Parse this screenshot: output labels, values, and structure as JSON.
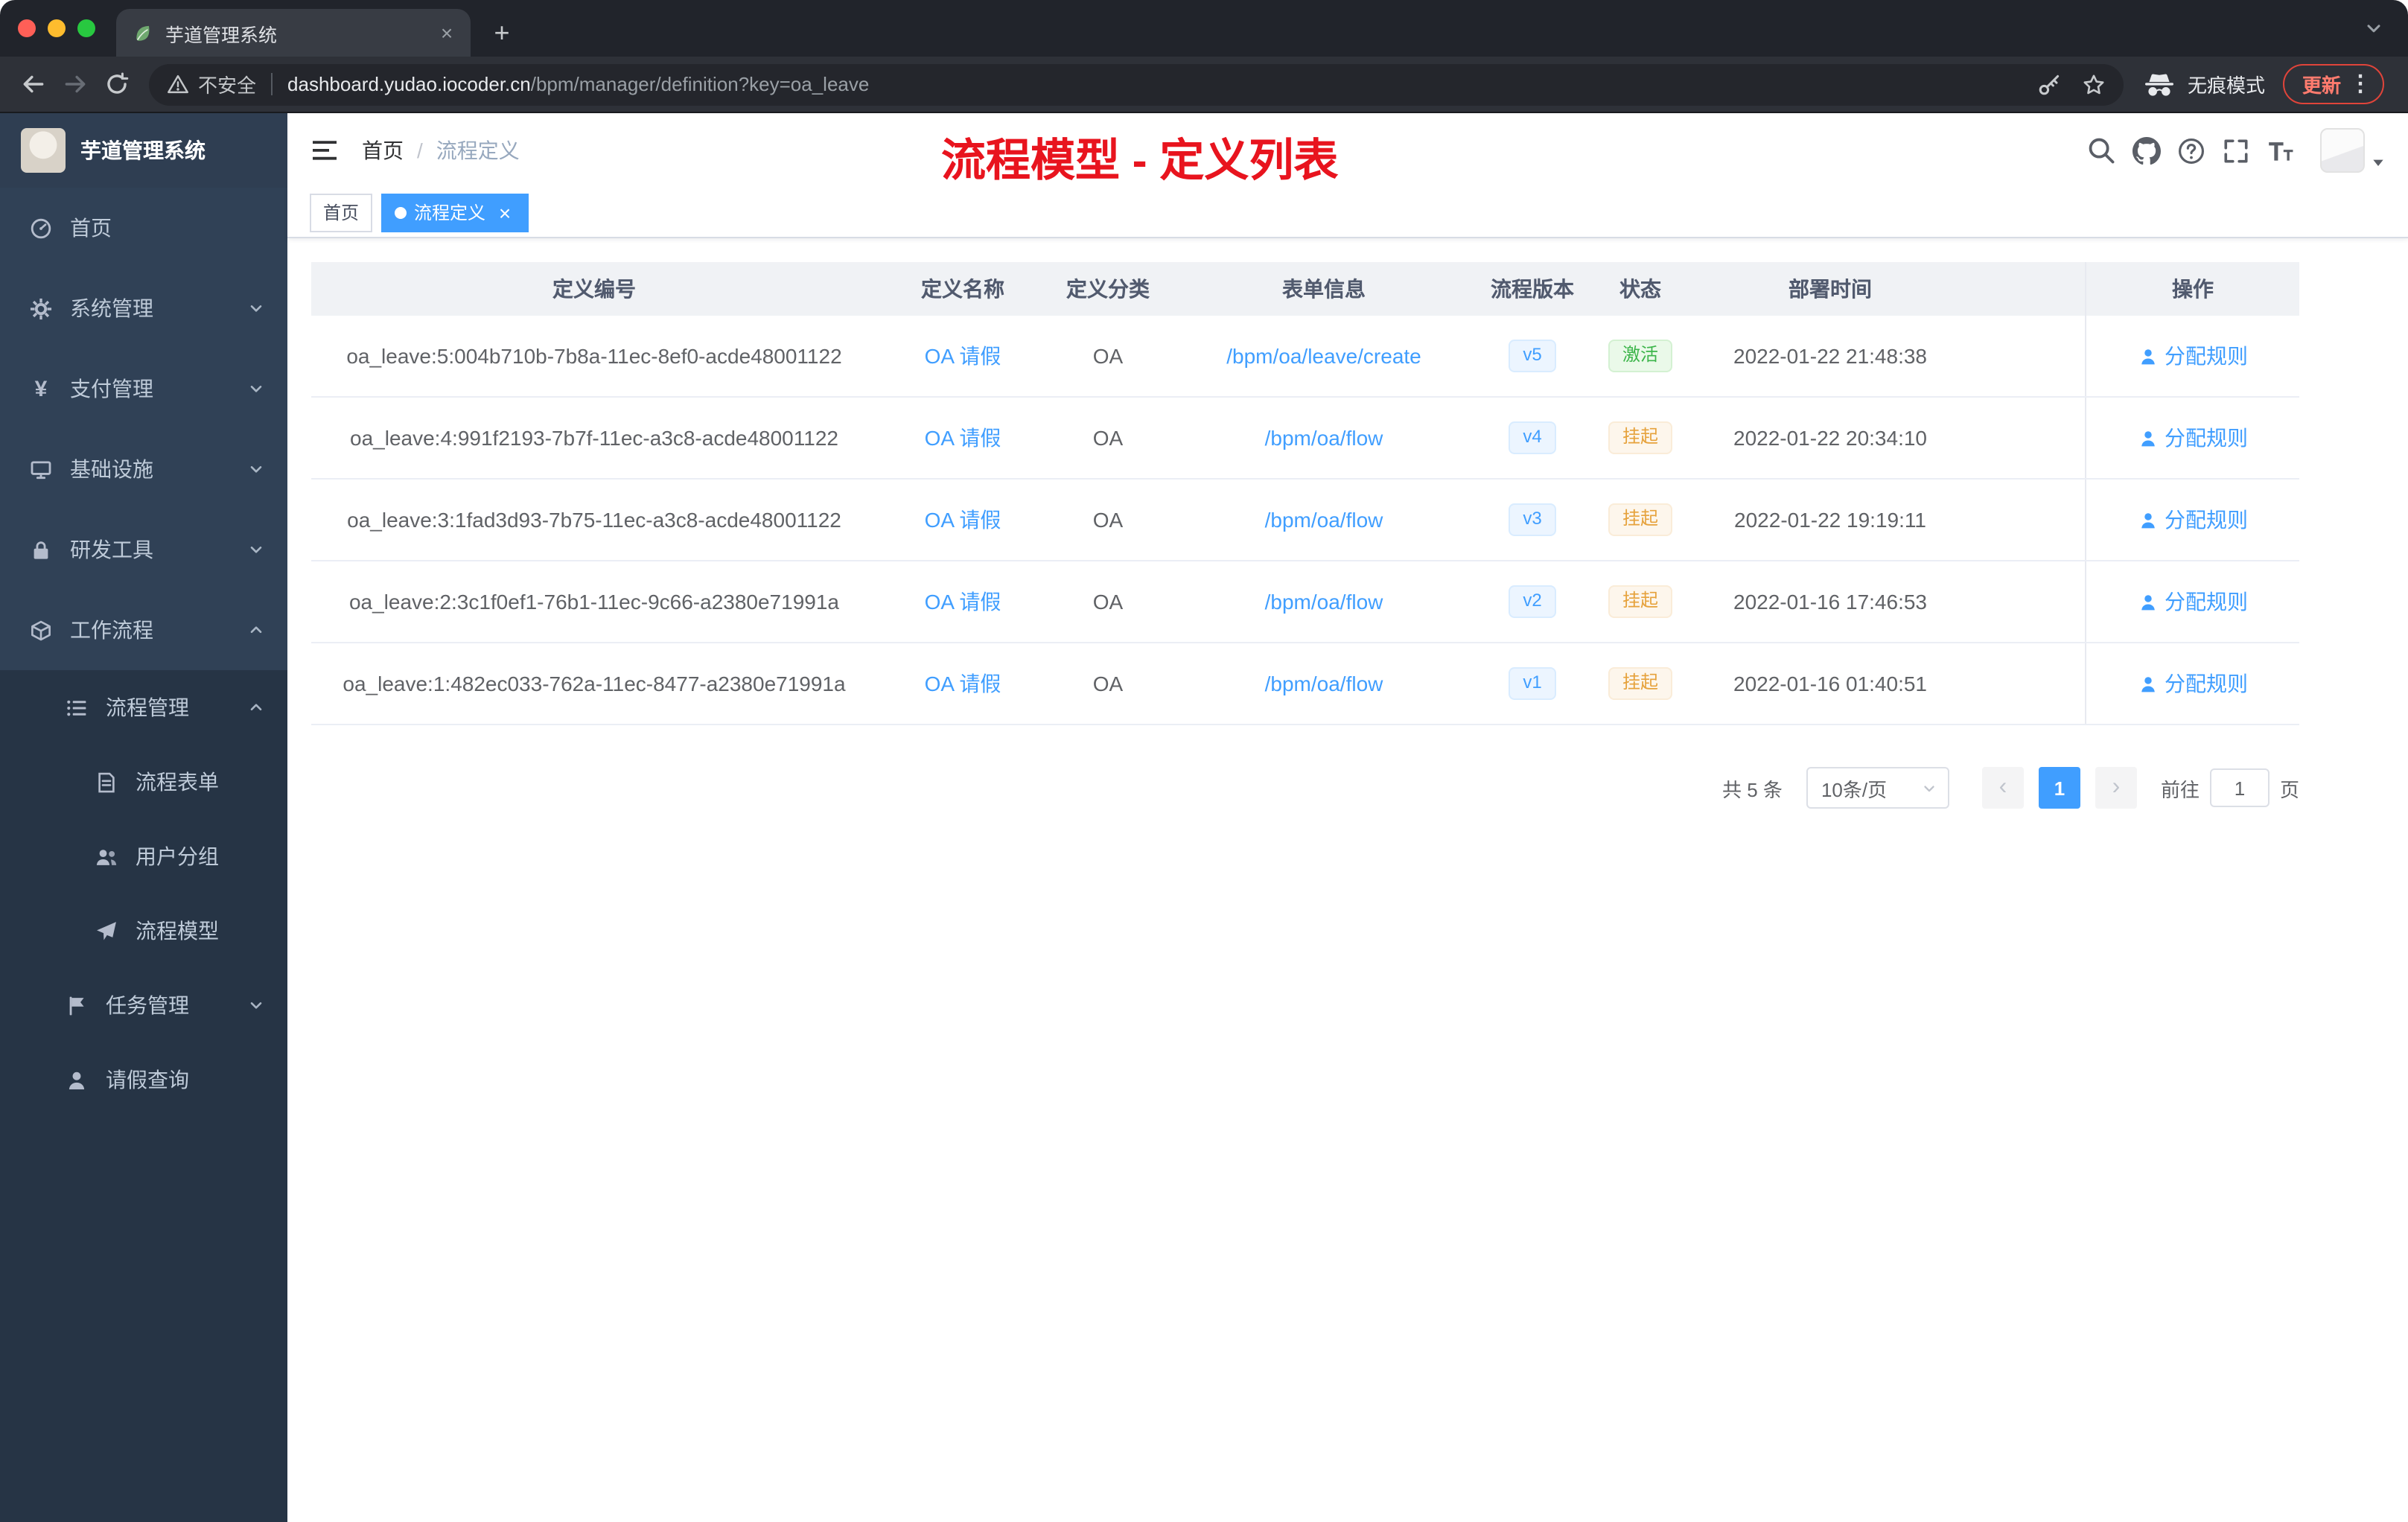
{
  "browser": {
    "tab_title": "芋道管理系统",
    "security_label": "不安全",
    "url_host": "dashboard.yudao.iocoder.cn",
    "url_path": "/bpm/manager/definition?key=oa_leave",
    "incognito_label": "无痕模式",
    "update_label": "更新"
  },
  "sidebar": {
    "logo_title": "芋道管理系统",
    "items": [
      {
        "label": "首页",
        "icon": "dashboard-icon",
        "level": 1,
        "chevron": "",
        "dark": false
      },
      {
        "label": "系统管理",
        "icon": "gear-icon",
        "level": 1,
        "chevron": "down",
        "dark": false
      },
      {
        "label": "支付管理",
        "icon": "yen-icon",
        "level": 1,
        "chevron": "down",
        "dark": false
      },
      {
        "label": "基础设施",
        "icon": "monitor-icon",
        "level": 1,
        "chevron": "down",
        "dark": false
      },
      {
        "label": "研发工具",
        "icon": "lock-icon",
        "level": 1,
        "chevron": "down",
        "dark": false
      },
      {
        "label": "工作流程",
        "icon": "workflow-icon",
        "level": 1,
        "chevron": "up",
        "dark": false
      },
      {
        "label": "流程管理",
        "icon": "list-icon",
        "level": 2,
        "chevron": "up",
        "dark": true
      },
      {
        "label": "流程表单",
        "icon": "form-icon",
        "level": 3,
        "chevron": "",
        "dark": true
      },
      {
        "label": "用户分组",
        "icon": "users-icon",
        "level": 3,
        "chevron": "",
        "dark": true
      },
      {
        "label": "流程模型",
        "icon": "send-icon",
        "level": 3,
        "chevron": "",
        "dark": true
      },
      {
        "label": "任务管理",
        "icon": "flag-icon",
        "level": 2,
        "chevron": "down",
        "dark": true
      },
      {
        "label": "请假查询",
        "icon": "user-icon",
        "level": 2,
        "chevron": "",
        "dark": true
      }
    ]
  },
  "navbar": {
    "breadcrumb": [
      "首页",
      "流程定义"
    ],
    "breadcrumb_separator": "/",
    "annotation": "流程模型 - 定义列表"
  },
  "tags": [
    {
      "label": "首页",
      "active": false
    },
    {
      "label": "流程定义",
      "active": true
    }
  ],
  "table": {
    "headers": [
      "定义编号",
      "定义名称",
      "定义分类",
      "表单信息",
      "流程版本",
      "状态",
      "部署时间",
      "操作"
    ],
    "action_label": "分配规则",
    "rows": [
      {
        "id": "oa_leave:5:004b710b-7b8a-11ec-8ef0-acde48001122",
        "name": "OA 请假",
        "category": "OA",
        "form": "/bpm/oa/leave/create",
        "version": "v5",
        "status": "激活",
        "status_type": "success",
        "time": "2022-01-22 21:48:38"
      },
      {
        "id": "oa_leave:4:991f2193-7b7f-11ec-a3c8-acde48001122",
        "name": "OA 请假",
        "category": "OA",
        "form": "/bpm/oa/flow",
        "version": "v4",
        "status": "挂起",
        "status_type": "warning",
        "time": "2022-01-22 20:34:10"
      },
      {
        "id": "oa_leave:3:1fad3d93-7b75-11ec-a3c8-acde48001122",
        "name": "OA 请假",
        "category": "OA",
        "form": "/bpm/oa/flow",
        "version": "v3",
        "status": "挂起",
        "status_type": "warning",
        "time": "2022-01-22 19:19:11"
      },
      {
        "id": "oa_leave:2:3c1f0ef1-76b1-11ec-9c66-a2380e71991a",
        "name": "OA 请假",
        "category": "OA",
        "form": "/bpm/oa/flow",
        "version": "v2",
        "status": "挂起",
        "status_type": "warning",
        "time": "2022-01-16 17:46:53"
      },
      {
        "id": "oa_leave:1:482ec033-762a-11ec-8477-a2380e71991a",
        "name": "OA 请假",
        "category": "OA",
        "form": "/bpm/oa/flow",
        "version": "v1",
        "status": "挂起",
        "status_type": "warning",
        "time": "2022-01-16 01:40:51"
      }
    ]
  },
  "pagination": {
    "total": "共 5 条",
    "page_size": "10条/页",
    "current_page": "1",
    "goto_label": "前往",
    "goto_value": "1",
    "unit_label": "页"
  },
  "colors": {
    "accent": "#409eff",
    "success": "#3cb54a",
    "warning": "#e6a23c",
    "annotation_red": "#e8141e",
    "sidebar": "#304156",
    "sidebar_dark": "#263445"
  }
}
